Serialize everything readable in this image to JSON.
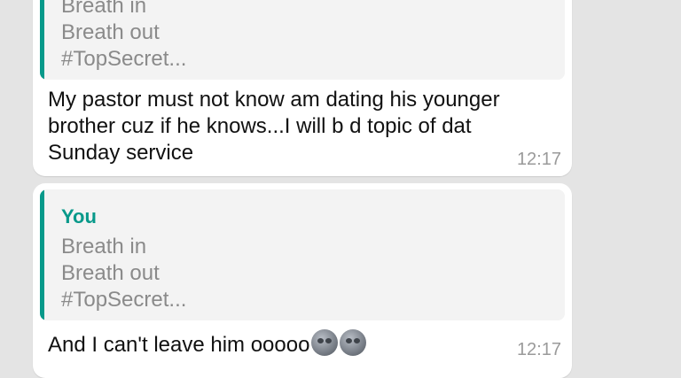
{
  "messages": [
    {
      "quote": {
        "author": "",
        "lines": [
          "Breath in",
          "Breath out",
          "#TopSecret..."
        ]
      },
      "text": "My pastor must not know am dating his younger",
      "text_line2": "brother cuz if he knows...I will b d topic of dat",
      "text_line3": "Sunday service",
      "time": "12:17"
    },
    {
      "quote": {
        "author": "You",
        "lines": [
          "Breath in",
          "Breath out",
          "#TopSecret..."
        ]
      },
      "text": "And I can't leave him ooooo",
      "emojis": [
        "new-moon-face-icon",
        "new-moon-face-icon"
      ],
      "time": "12:17"
    }
  ],
  "colors": {
    "accent": "#07998a",
    "background": "#e4e4e4",
    "bubble": "#ffffff",
    "quote_bg": "#f3f3f3"
  }
}
